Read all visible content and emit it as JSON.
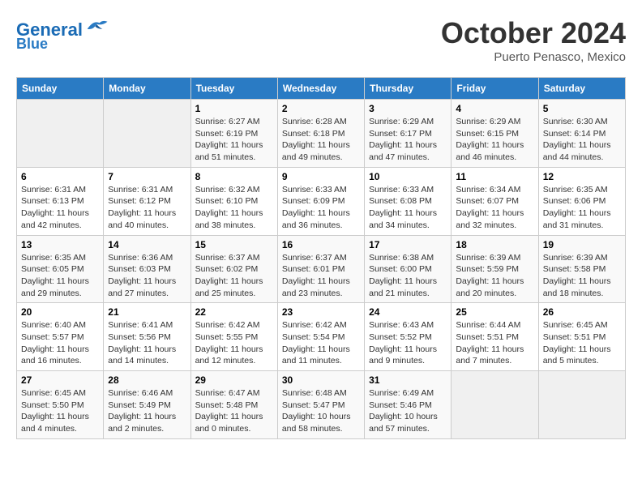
{
  "header": {
    "logo_line1": "General",
    "logo_line2": "Blue",
    "month": "October 2024",
    "location": "Puerto Penasco, Mexico"
  },
  "columns": [
    "Sunday",
    "Monday",
    "Tuesday",
    "Wednesday",
    "Thursday",
    "Friday",
    "Saturday"
  ],
  "weeks": [
    [
      {
        "day": "",
        "sunrise": "",
        "sunset": "",
        "daylight": ""
      },
      {
        "day": "",
        "sunrise": "",
        "sunset": "",
        "daylight": ""
      },
      {
        "day": "1",
        "sunrise": "Sunrise: 6:27 AM",
        "sunset": "Sunset: 6:19 PM",
        "daylight": "Daylight: 11 hours and 51 minutes."
      },
      {
        "day": "2",
        "sunrise": "Sunrise: 6:28 AM",
        "sunset": "Sunset: 6:18 PM",
        "daylight": "Daylight: 11 hours and 49 minutes."
      },
      {
        "day": "3",
        "sunrise": "Sunrise: 6:29 AM",
        "sunset": "Sunset: 6:17 PM",
        "daylight": "Daylight: 11 hours and 47 minutes."
      },
      {
        "day": "4",
        "sunrise": "Sunrise: 6:29 AM",
        "sunset": "Sunset: 6:15 PM",
        "daylight": "Daylight: 11 hours and 46 minutes."
      },
      {
        "day": "5",
        "sunrise": "Sunrise: 6:30 AM",
        "sunset": "Sunset: 6:14 PM",
        "daylight": "Daylight: 11 hours and 44 minutes."
      }
    ],
    [
      {
        "day": "6",
        "sunrise": "Sunrise: 6:31 AM",
        "sunset": "Sunset: 6:13 PM",
        "daylight": "Daylight: 11 hours and 42 minutes."
      },
      {
        "day": "7",
        "sunrise": "Sunrise: 6:31 AM",
        "sunset": "Sunset: 6:12 PM",
        "daylight": "Daylight: 11 hours and 40 minutes."
      },
      {
        "day": "8",
        "sunrise": "Sunrise: 6:32 AM",
        "sunset": "Sunset: 6:10 PM",
        "daylight": "Daylight: 11 hours and 38 minutes."
      },
      {
        "day": "9",
        "sunrise": "Sunrise: 6:33 AM",
        "sunset": "Sunset: 6:09 PM",
        "daylight": "Daylight: 11 hours and 36 minutes."
      },
      {
        "day": "10",
        "sunrise": "Sunrise: 6:33 AM",
        "sunset": "Sunset: 6:08 PM",
        "daylight": "Daylight: 11 hours and 34 minutes."
      },
      {
        "day": "11",
        "sunrise": "Sunrise: 6:34 AM",
        "sunset": "Sunset: 6:07 PM",
        "daylight": "Daylight: 11 hours and 32 minutes."
      },
      {
        "day": "12",
        "sunrise": "Sunrise: 6:35 AM",
        "sunset": "Sunset: 6:06 PM",
        "daylight": "Daylight: 11 hours and 31 minutes."
      }
    ],
    [
      {
        "day": "13",
        "sunrise": "Sunrise: 6:35 AM",
        "sunset": "Sunset: 6:05 PM",
        "daylight": "Daylight: 11 hours and 29 minutes."
      },
      {
        "day": "14",
        "sunrise": "Sunrise: 6:36 AM",
        "sunset": "Sunset: 6:03 PM",
        "daylight": "Daylight: 11 hours and 27 minutes."
      },
      {
        "day": "15",
        "sunrise": "Sunrise: 6:37 AM",
        "sunset": "Sunset: 6:02 PM",
        "daylight": "Daylight: 11 hours and 25 minutes."
      },
      {
        "day": "16",
        "sunrise": "Sunrise: 6:37 AM",
        "sunset": "Sunset: 6:01 PM",
        "daylight": "Daylight: 11 hours and 23 minutes."
      },
      {
        "day": "17",
        "sunrise": "Sunrise: 6:38 AM",
        "sunset": "Sunset: 6:00 PM",
        "daylight": "Daylight: 11 hours and 21 minutes."
      },
      {
        "day": "18",
        "sunrise": "Sunrise: 6:39 AM",
        "sunset": "Sunset: 5:59 PM",
        "daylight": "Daylight: 11 hours and 20 minutes."
      },
      {
        "day": "19",
        "sunrise": "Sunrise: 6:39 AM",
        "sunset": "Sunset: 5:58 PM",
        "daylight": "Daylight: 11 hours and 18 minutes."
      }
    ],
    [
      {
        "day": "20",
        "sunrise": "Sunrise: 6:40 AM",
        "sunset": "Sunset: 5:57 PM",
        "daylight": "Daylight: 11 hours and 16 minutes."
      },
      {
        "day": "21",
        "sunrise": "Sunrise: 6:41 AM",
        "sunset": "Sunset: 5:56 PM",
        "daylight": "Daylight: 11 hours and 14 minutes."
      },
      {
        "day": "22",
        "sunrise": "Sunrise: 6:42 AM",
        "sunset": "Sunset: 5:55 PM",
        "daylight": "Daylight: 11 hours and 12 minutes."
      },
      {
        "day": "23",
        "sunrise": "Sunrise: 6:42 AM",
        "sunset": "Sunset: 5:54 PM",
        "daylight": "Daylight: 11 hours and 11 minutes."
      },
      {
        "day": "24",
        "sunrise": "Sunrise: 6:43 AM",
        "sunset": "Sunset: 5:52 PM",
        "daylight": "Daylight: 11 hours and 9 minutes."
      },
      {
        "day": "25",
        "sunrise": "Sunrise: 6:44 AM",
        "sunset": "Sunset: 5:51 PM",
        "daylight": "Daylight: 11 hours and 7 minutes."
      },
      {
        "day": "26",
        "sunrise": "Sunrise: 6:45 AM",
        "sunset": "Sunset: 5:51 PM",
        "daylight": "Daylight: 11 hours and 5 minutes."
      }
    ],
    [
      {
        "day": "27",
        "sunrise": "Sunrise: 6:45 AM",
        "sunset": "Sunset: 5:50 PM",
        "daylight": "Daylight: 11 hours and 4 minutes."
      },
      {
        "day": "28",
        "sunrise": "Sunrise: 6:46 AM",
        "sunset": "Sunset: 5:49 PM",
        "daylight": "Daylight: 11 hours and 2 minutes."
      },
      {
        "day": "29",
        "sunrise": "Sunrise: 6:47 AM",
        "sunset": "Sunset: 5:48 PM",
        "daylight": "Daylight: 11 hours and 0 minutes."
      },
      {
        "day": "30",
        "sunrise": "Sunrise: 6:48 AM",
        "sunset": "Sunset: 5:47 PM",
        "daylight": "Daylight: 10 hours and 58 minutes."
      },
      {
        "day": "31",
        "sunrise": "Sunrise: 6:49 AM",
        "sunset": "Sunset: 5:46 PM",
        "daylight": "Daylight: 10 hours and 57 minutes."
      },
      {
        "day": "",
        "sunrise": "",
        "sunset": "",
        "daylight": ""
      },
      {
        "day": "",
        "sunrise": "",
        "sunset": "",
        "daylight": ""
      }
    ]
  ]
}
